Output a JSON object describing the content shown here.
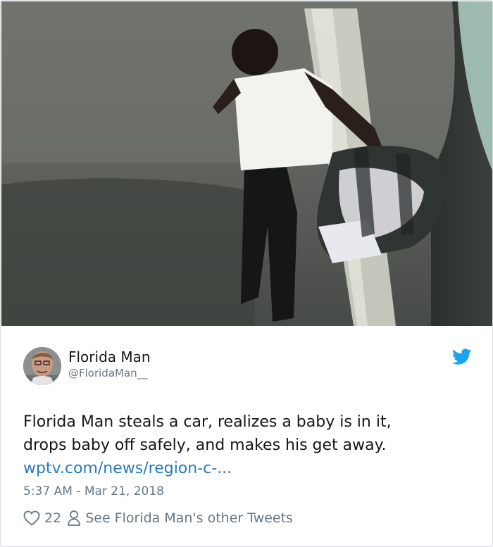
{
  "photo": {
    "description_icon": "surveillance-photo"
  },
  "author": {
    "display_name": "Florida Man",
    "handle": "@FloridaMan__",
    "avatar_icon": "avatar"
  },
  "brand": {
    "icon": "twitter-bird-icon",
    "color": "#1da1f2"
  },
  "tweet": {
    "text_line_1": "Florida Man steals a car, realizes a baby is in it,",
    "text_line_2": "drops baby off safely, and makes his get away.",
    "link_text": "wptv.com/news/region-c-...",
    "timestamp": "5:37 AM - Mar 21, 2018"
  },
  "actions": {
    "like_icon": "heart-icon",
    "like_count": "22",
    "profile_icon": "person-icon",
    "other_tweets_label": "See Florida Man's other Tweets"
  },
  "colors": {
    "text": "#14171a",
    "secondary": "#657786",
    "link": "#2b7bb9"
  }
}
